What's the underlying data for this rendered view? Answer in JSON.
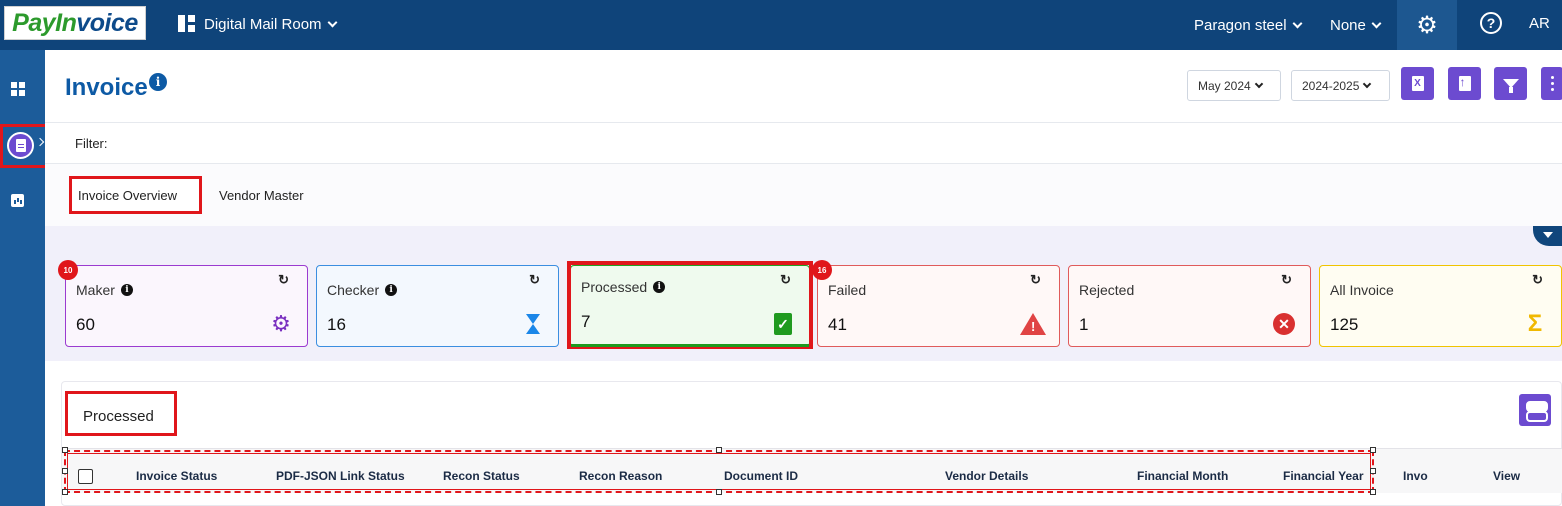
{
  "brand": {
    "logo_part1": "PayIn",
    "logo_part2": "v",
    "logo_part3": "oice"
  },
  "topbar": {
    "app_menu": "Digital Mail Room",
    "company": "Paragon steel",
    "scope": "None",
    "user_initials": "AR",
    "help_glyph": "?"
  },
  "page": {
    "title": "Invoice",
    "info_glyph": "i",
    "month_select": "May 2024",
    "year_select": "2024-2025",
    "actions": {
      "excel": "X"
    }
  },
  "filter": {
    "label": "Filter:"
  },
  "tabs": [
    {
      "label": "Invoice Overview",
      "selected": true
    },
    {
      "label": "Vendor Master",
      "selected": false
    }
  ],
  "cards": [
    {
      "key": "maker",
      "label": "Maker",
      "value": "60",
      "badge": "10",
      "icon": "gear-icon"
    },
    {
      "key": "checker",
      "label": "Checker",
      "value": "16",
      "icon": "hourglass-icon"
    },
    {
      "key": "processed",
      "label": "Processed",
      "value": "7",
      "badge": "16",
      "icon": "file-check-icon",
      "selected": true
    },
    {
      "key": "failed",
      "label": "Failed",
      "value": "41",
      "icon": "warning-icon"
    },
    {
      "key": "rejected",
      "label": "Rejected",
      "value": "1",
      "icon": "x-circle-icon"
    },
    {
      "key": "all",
      "label": "All Invoice",
      "value": "125",
      "icon": "sigma-icon"
    }
  ],
  "card_glyphs": {
    "refresh": "↻",
    "check": "✓",
    "x": "✕",
    "sigma": "Σ",
    "gear": "⚙"
  },
  "section": {
    "title": "Processed",
    "columns": [
      "Invoice Status",
      "PDF-JSON Link Status",
      "Recon Status",
      "Recon Reason",
      "Document ID",
      "Vendor Details",
      "Financial Month",
      "Financial Year",
      "Invo",
      "View"
    ]
  },
  "colors": {
    "topbar": "#0f447a",
    "sidebar": "#1c5c9a",
    "accent": "#6c4bd0",
    "title": "#0d5aa5",
    "highlight": "#e0161b"
  }
}
